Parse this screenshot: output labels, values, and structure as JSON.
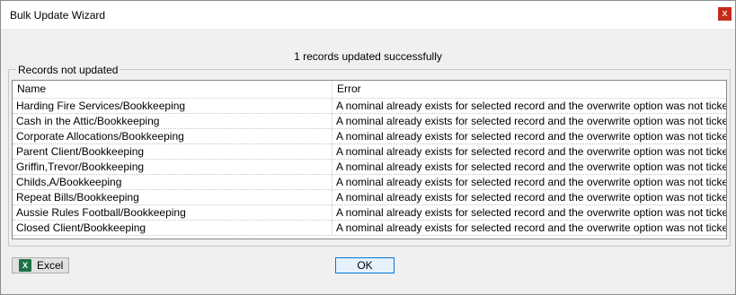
{
  "window": {
    "title": "Bulk Update Wizard",
    "close_glyph": "x"
  },
  "message": "1 records updated successfully",
  "group": {
    "label": "Records not updated"
  },
  "grid": {
    "columns": [
      "Name",
      "Error"
    ],
    "rows": [
      {
        "name": "Harding Fire Services/Bookkeeping",
        "error": "A nominal already exists for selected record and the overwrite option was not ticked"
      },
      {
        "name": "Cash in the Attic/Bookkeeping",
        "error": "A nominal already exists for selected record and the overwrite option was not ticked"
      },
      {
        "name": "Corporate Allocations/Bookkeeping",
        "error": "A nominal already exists for selected record and the overwrite option was not ticked"
      },
      {
        "name": "Parent Client/Bookkeeping",
        "error": "A nominal already exists for selected record and the overwrite option was not ticked"
      },
      {
        "name": "Griffin,Trevor/Bookkeeping",
        "error": "A nominal already exists for selected record and the overwrite option was not ticked"
      },
      {
        "name": "Childs,A/Bookkeeping",
        "error": "A nominal already exists for selected record and the overwrite option was not ticked"
      },
      {
        "name": "Repeat Bills/Bookkeeping",
        "error": "A nominal already exists for selected record and the overwrite option was not ticked"
      },
      {
        "name": "Aussie Rules Football/Bookkeeping",
        "error": "A nominal already exists for selected record and the overwrite option was not ticked"
      },
      {
        "name": "Closed Client/Bookkeeping",
        "error": "A nominal already exists for selected record and the overwrite option was not ticked"
      }
    ]
  },
  "buttons": {
    "excel": "Excel",
    "excel_icon": "excel-icon",
    "ok": "OK"
  },
  "colors": {
    "close": "#c42b1c",
    "excel_green": "#1e7145",
    "focus_border": "#0078d7"
  }
}
